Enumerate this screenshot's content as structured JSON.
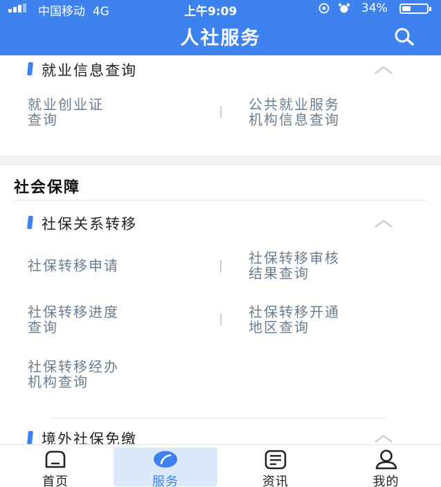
{
  "status_bar": {
    "carrier": "中国移动",
    "network": "4G",
    "time": "上午9:09",
    "battery_percent": "34%",
    "battery_level": 0.34
  },
  "header": {
    "title": "人社服务"
  },
  "employment": {
    "subtitle": "就业信息查询",
    "items": [
      "就业创业证",
      "查询",
      "公共就业服务",
      "机构信息查询"
    ]
  },
  "social_security": {
    "section_title": "社会保障",
    "transfer": {
      "subtitle": "社保关系转移",
      "items": [
        "社保转移申请",
        "社保转移审核",
        "结果查询",
        "社保转移进度",
        "查询",
        "社保转移开通",
        "地区查询",
        "社保转移经办",
        "机构查询"
      ]
    },
    "overseas": {
      "subtitle": "境外社保免缴"
    }
  },
  "tabbar": {
    "tabs": [
      {
        "label": "首页",
        "icon": "home-icon"
      },
      {
        "label": "服务",
        "icon": "service-leaf-icon"
      },
      {
        "label": "资讯",
        "icon": "news-icon"
      },
      {
        "label": "我的",
        "icon": "profile-icon"
      }
    ],
    "active_tab": "服务"
  },
  "colors": {
    "accent": "#3d82ee",
    "item_text": "#6a7d90",
    "active_tab_bg": "#dbe9fb"
  }
}
